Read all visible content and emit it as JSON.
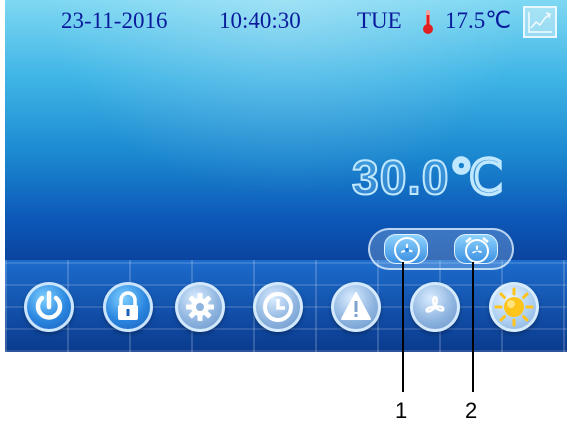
{
  "status_bar": {
    "date": "23-11-2016",
    "time": "10:40:30",
    "day": "TUE",
    "temperature": "17.5℃",
    "thermometer_icon": "thermometer-icon",
    "trend_icon": "trend-chart-icon"
  },
  "display": {
    "set_temperature": "30.0℃"
  },
  "mode_indicator": {
    "icons": [
      "fan-icon",
      "alarm-clock-fan-icon"
    ]
  },
  "bottom_buttons": [
    {
      "icon": "power-icon"
    },
    {
      "icon": "lock-icon"
    },
    {
      "icon": "gear-icon"
    },
    {
      "icon": "clock-icon"
    },
    {
      "icon": "warning-icon"
    },
    {
      "icon": "fan-icon"
    },
    {
      "icon": "sun-icon"
    }
  ],
  "callouts": {
    "label_1": "1",
    "label_2": "2"
  },
  "colors": {
    "status_text": "#0a1a9c",
    "thermometer": "#e02020",
    "sun": "#ffc41a"
  }
}
